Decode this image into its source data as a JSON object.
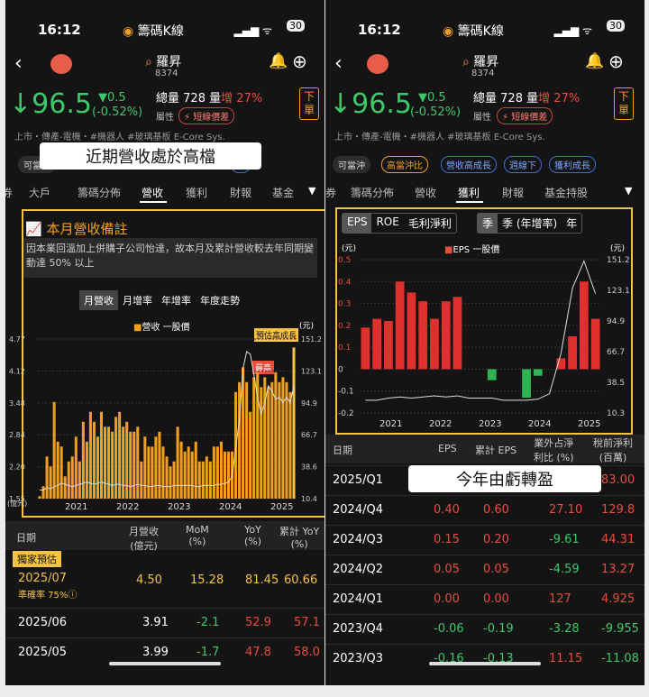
{
  "status": {
    "time": "16:12",
    "app_name": "籌碼K線",
    "battery": "30"
  },
  "stock": {
    "name": "羅昇",
    "code": "8374",
    "price": "96.5",
    "change": "▼0.5",
    "change_pct": "(-0.52%)",
    "total_volume_label": "總量",
    "total_volume": "728",
    "volume_label": "量",
    "volume_change_label": "增",
    "volume_change_pct": "27%",
    "attr_label": "屬性",
    "attr_badge": "短線價差",
    "order_button": "下單",
    "tags_text": "上市・傳產-電機・#機器人 #玻璃基板 E-Core Sys."
  },
  "colors": {
    "up": "#e74c3c",
    "down": "#3fc76b",
    "accent": "#f0a020",
    "highlight_border": "#f5c242"
  },
  "left": {
    "chips": [
      "可當沖",
      "營收高成長"
    ],
    "overlay_caption": "近期營收處於高檔",
    "tabs": [
      "券",
      "大戶",
      "籌碼分佈",
      "營收",
      "獲利",
      "財報",
      "基金"
    ],
    "active_tab": "營收",
    "card": {
      "title": "本月營收備註",
      "note": "因本業回溫加上併購子公司怡達，故本月及累計營收較去年同期變動達 50% 以上",
      "segments": [
        "月營收",
        "月增率",
        "年增率",
        "年度走勢"
      ],
      "legend": [
        "營收",
        "一股價"
      ],
      "right_unit": "(元)",
      "left_unit": "(億元)",
      "tag_forecast": "預估高成長",
      "tag_high": "最高"
    },
    "table": {
      "headers": [
        "日期",
        "月營收\n(億元)",
        "MoM\n(%)",
        "YoY\n(%)",
        "累計 YoY\n(%)"
      ],
      "exclusive": "獨家預估",
      "forecast_row": {
        "date": "2025/07",
        "accuracy": "準確率 75%ⓘ",
        "rev": "4.50",
        "mom": "15.28",
        "yoy": "81.45",
        "cum": "60.66"
      },
      "rows": [
        {
          "date": "2025/06",
          "rev": "3.91",
          "mom": "-2.1",
          "yoy": "52.9",
          "cum": "57.1"
        },
        {
          "date": "2025/05",
          "rev": "3.99",
          "mom": "-1.7",
          "yoy": "47.8",
          "cum": "58.0"
        }
      ]
    }
  },
  "right": {
    "chips": [
      "可當沖",
      "高當沖比",
      "營收高成長",
      "週線下",
      "獲利成長"
    ],
    "tabs": [
      "券",
      "籌碼分佈",
      "營收",
      "獲利",
      "財報",
      "基金持股"
    ],
    "active_tab": "獲利",
    "metric_tabs": [
      "EPS",
      "ROE",
      "毛利淨利"
    ],
    "period_tabs": [
      "季",
      "季 (年增率)",
      "年"
    ],
    "legend": [
      "EPS",
      "一股價"
    ],
    "left_unit": "(元)",
    "right_unit": "(元)",
    "overlay_caption": "今年由虧轉盈",
    "table": {
      "headers": [
        "日期",
        "EPS",
        "累計 EPS",
        "業外占淨\n利比 (%)",
        "稅前淨利\n(百萬)"
      ],
      "rows": [
        {
          "date": "2025/Q1",
          "eps": "",
          "cum": "",
          "nonop": "",
          "pretax": "83.00"
        },
        {
          "date": "2024/Q4",
          "eps": "0.40",
          "cum": "0.60",
          "nonop": "27.10",
          "pretax": "129.8"
        },
        {
          "date": "2024/Q3",
          "eps": "0.15",
          "cum": "0.20",
          "nonop": "-9.61",
          "pretax": "44.31"
        },
        {
          "date": "2024/Q2",
          "eps": "0.05",
          "cum": "0.05",
          "nonop": "-4.59",
          "pretax": "13.27"
        },
        {
          "date": "2024/Q1",
          "eps": "0.00",
          "cum": "0.00",
          "nonop": "127",
          "pretax": "4.925"
        },
        {
          "date": "2023/Q4",
          "eps": "-0.06",
          "cum": "-0.19",
          "nonop": "-3.28",
          "pretax": "-9.955"
        },
        {
          "date": "2023/Q3",
          "eps": "-0.16",
          "cum": "-0.13",
          "nonop": "11.15",
          "pretax": "-11.08"
        }
      ]
    }
  },
  "chart_data": [
    {
      "type": "bar",
      "title": "月營收",
      "y_left_ticks": [
        "4.77",
        "4.12",
        "3.48",
        "2.84",
        "2.20",
        "1.55"
      ],
      "y_right_ticks": [
        "151.2",
        "123.1",
        "94.9",
        "66.7",
        "38.6",
        "10.4"
      ],
      "x_labels": [
        "2021",
        "2022",
        "2023",
        "2024",
        "2025"
      ],
      "ylim": [
        1.55,
        4.77
      ],
      "series": [
        {
          "name": "營收",
          "values": [
            1.6,
            1.8,
            2.4,
            2.2,
            3.5,
            2.7,
            2.6,
            2.0,
            2.3,
            2.4,
            2.8,
            2.3,
            3.1,
            2.7,
            3.3,
            3.1,
            2.8,
            3.3,
            3.0,
            3.0,
            2.9,
            3.2,
            3.3,
            3.0,
            3.1,
            2.9,
            2.9,
            3.0,
            2.3,
            2.8,
            2.6,
            2.6,
            2.8,
            2.9,
            2.6,
            2.4,
            2.2,
            2.3,
            3.0,
            2.7,
            2.5,
            2.6,
            2.5,
            2.7,
            2.3,
            2.3,
            2.4,
            2.3,
            2.6,
            2.6,
            2.7,
            2.5,
            2.5,
            2.5,
            3.7,
            3.9,
            4.2,
            3.9,
            3.3,
            4.0,
            4.1,
            3.8,
            4.0,
            3.8,
            3.9,
            4.1,
            3.9,
            4.0,
            3.9,
            3.7,
            4.6
          ]
        },
        {
          "name": "一股價",
          "values": [
            18,
            18,
            20,
            19,
            21,
            22,
            24,
            23,
            22,
            21,
            22,
            23,
            24,
            25,
            24,
            23,
            24,
            25,
            24,
            23,
            22,
            23,
            23,
            22,
            22,
            21,
            22,
            23,
            22,
            22,
            21,
            21,
            22,
            22,
            21,
            21,
            21,
            22,
            22,
            22,
            22,
            22,
            22,
            21,
            21,
            22,
            22,
            22,
            22,
            23,
            23,
            24,
            25,
            30,
            55,
            80,
            125,
            140,
            138,
            120,
            100,
            85,
            95,
            110,
            105,
            98,
            100,
            95,
            100,
            95,
            110
          ]
        }
      ]
    },
    {
      "type": "bar",
      "title": "EPS",
      "y_left_ticks": [
        "0.5",
        "0.4",
        "0.3",
        "0.2",
        "0.1",
        "0",
        "-0.1",
        "-0.2"
      ],
      "y_right_ticks": [
        "151.2",
        "123.1",
        "94.9",
        "66.7",
        "38.5",
        "10.3"
      ],
      "x_labels": [
        "2021",
        "2022",
        "2023",
        "2024",
        "2025"
      ],
      "ylim": [
        -0.2,
        0.5
      ],
      "series": [
        {
          "name": "EPS",
          "values": [
            0.19,
            0.23,
            0.22,
            0.4,
            0.35,
            0.31,
            0.23,
            0.31,
            0.33,
            0.0,
            0.0,
            -0.05,
            0.0,
            0.0,
            -0.13,
            -0.03,
            0.0,
            0.05,
            0.15,
            0.4,
            0.23
          ]
        },
        {
          "name": "一股價",
          "values": [
            22,
            22,
            24,
            25,
            24,
            25,
            26,
            25,
            26,
            24,
            24,
            24,
            22,
            22,
            22,
            23,
            28,
            65,
            125,
            150,
            120
          ]
        }
      ]
    }
  ]
}
